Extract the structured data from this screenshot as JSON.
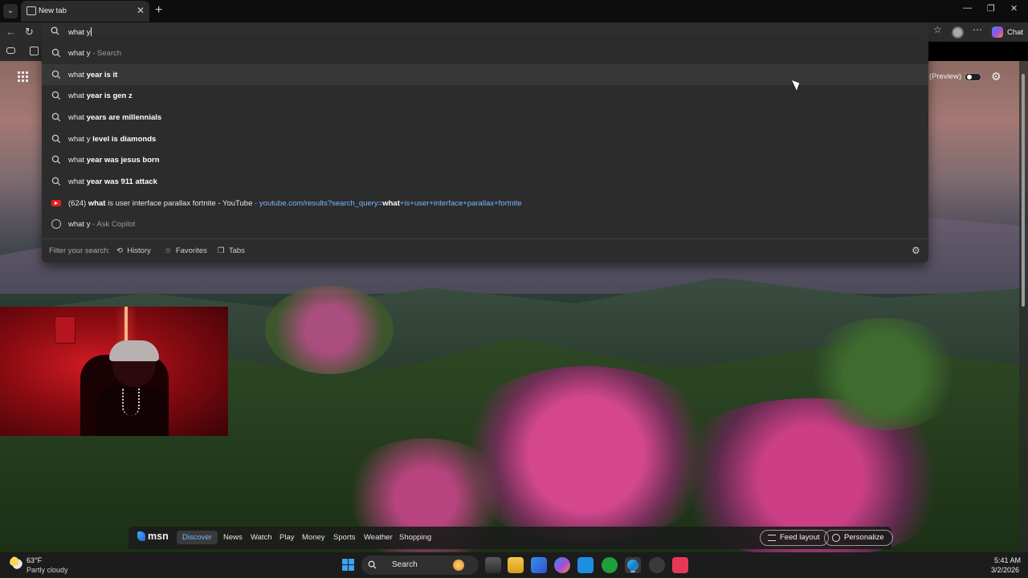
{
  "browser": {
    "tab": {
      "title": "New tab"
    },
    "address_bar": {
      "value": "what y"
    },
    "toolbar": {
      "chat_label": "Chat"
    }
  },
  "suggestions": [
    {
      "plain": "what y",
      "bold": "",
      "suffix": " - Search",
      "type": "search"
    },
    {
      "plain": "what ",
      "bold": "year is it",
      "suffix": "",
      "type": "search"
    },
    {
      "plain": "what ",
      "bold": "year is gen z",
      "suffix": "",
      "type": "search"
    },
    {
      "plain": "what ",
      "bold": "years are millennials",
      "suffix": "",
      "type": "search"
    },
    {
      "plain": "what y ",
      "bold": "level is diamonds",
      "suffix": "",
      "type": "search"
    },
    {
      "plain": "what ",
      "bold": "year was jesus born",
      "suffix": "",
      "type": "search"
    },
    {
      "plain": "what ",
      "bold": "year was 911 attack",
      "suffix": "",
      "type": "search"
    },
    {
      "plain": "what y",
      "bold": "",
      "suffix": " - Ask Copilot",
      "type": "copilot"
    }
  ],
  "youtube_suggestion": {
    "prefix": "(624) ",
    "bold": "what",
    "rest": " is user interface parallax fortnite - YouTube",
    "url_prefix": "youtube.com/results?search_query=",
    "url_bold": "what",
    "url_rest": "+is+user+interface+parallax+fortnite"
  },
  "filter": {
    "label": "Filter your search:",
    "options": [
      "History",
      "Favorites",
      "Tabs"
    ]
  },
  "page": {
    "preview_label": "(Preview)"
  },
  "msn": {
    "logo": "msn",
    "tabs": [
      "Discover",
      "News",
      "Watch",
      "Play",
      "Money",
      "Sports",
      "Weather",
      "Shopping"
    ],
    "active_tab": "Discover",
    "actions": [
      "Feed layout",
      "Personalize"
    ]
  },
  "taskbar": {
    "weather": {
      "temp": "63°F",
      "desc": "Partly cloudy"
    },
    "search_label": "Search",
    "clock": {
      "time": "5:41 AM",
      "date": "3/2/2026"
    }
  },
  "colors": {
    "accent": "#7ab6ff",
    "youtube_red": "#e62117",
    "windows_blue": "#3aa3f2"
  }
}
